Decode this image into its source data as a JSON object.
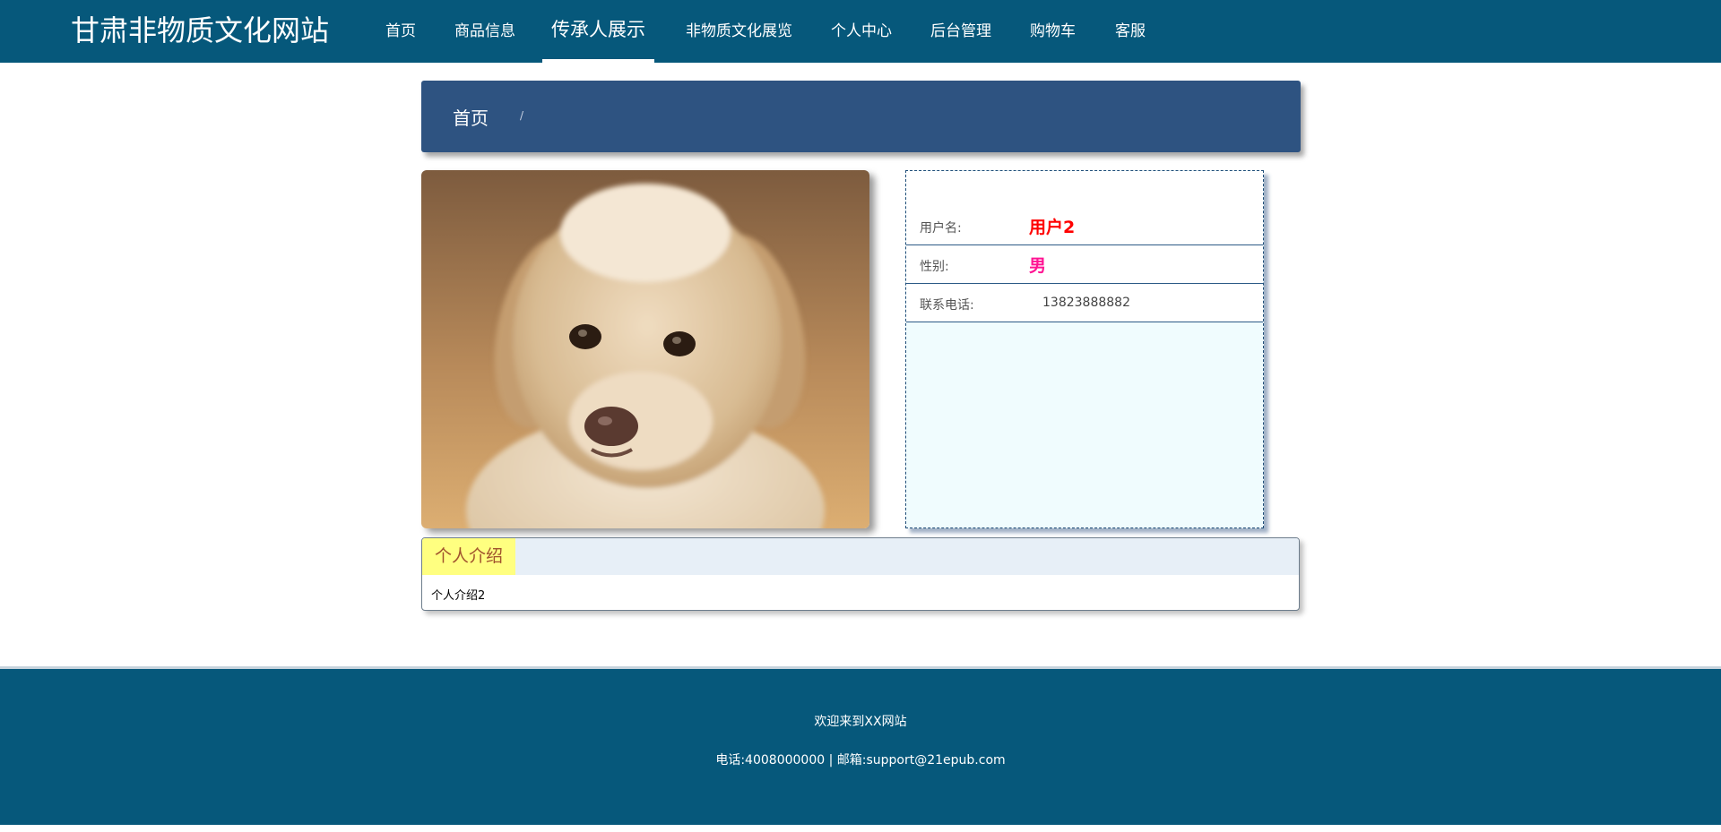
{
  "header": {
    "site_title": "甘肃非物质文化网站",
    "nav": [
      {
        "label": "首页"
      },
      {
        "label": "商品信息"
      },
      {
        "label": "传承人展示",
        "active": true
      },
      {
        "label": "非物质文化展览"
      },
      {
        "label": "个人中心"
      },
      {
        "label": "后台管理"
      },
      {
        "label": "购物车"
      },
      {
        "label": "客服"
      }
    ]
  },
  "breadcrumb": {
    "home": "首页",
    "separator": "/"
  },
  "profile": {
    "photo_subject": "puppy",
    "fields": [
      {
        "label": "用户名:",
        "value": "用户2",
        "color": "#ff0000"
      },
      {
        "label": "性别:",
        "value": "男",
        "color": "#ff1493"
      },
      {
        "label": "联系电话:",
        "value": "13823888882"
      }
    ]
  },
  "intro": {
    "tab_label": "个人介绍",
    "content": "个人介绍2"
  },
  "footer": {
    "welcome": "欢迎来到XX网站",
    "contact": "电话:4008000000 | 邮箱:support@21epub.com"
  },
  "colors": {
    "nav_bg": "#06587b",
    "breadcrumb_bg": "#2e5381",
    "intro_tab_bg": "#ffff80"
  }
}
